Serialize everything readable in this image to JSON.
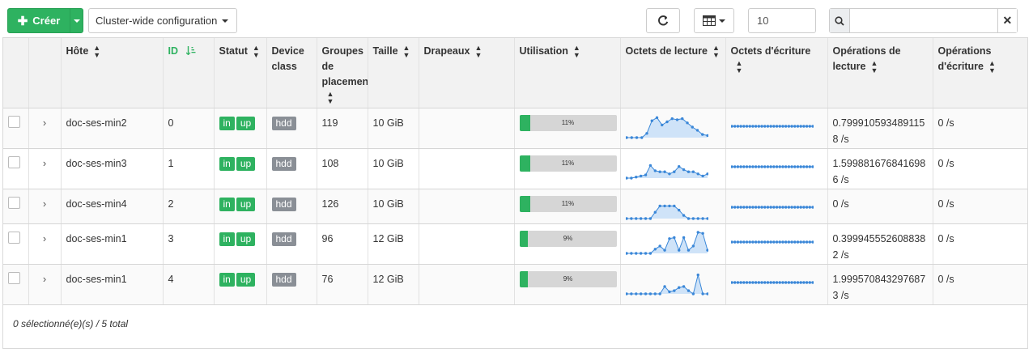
{
  "toolbar": {
    "create_label": "Créer",
    "cluster_label": "Cluster-wide configuration",
    "page_size": "10",
    "search_placeholder": "",
    "icons": {
      "create": "plus-icon",
      "refresh": "refresh-icon",
      "columns": "table-columns-icon",
      "search": "search-icon",
      "clear": "close-icon"
    }
  },
  "columns": {
    "host": "Hôte",
    "id": "ID",
    "status": "Statut",
    "device_class": "Device class",
    "pgs": "Groupes de placement",
    "size": "Taille",
    "flags": "Drapeaux",
    "usage": "Utilisation",
    "read_bytes": "Octets de lecture",
    "write_bytes": "Octets d'écriture",
    "read_ops": "Opérations de lecture",
    "write_ops": "Opérations d'écriture"
  },
  "rows": [
    {
      "host": "doc-ses-min2",
      "id": "0",
      "status": [
        "in",
        "up"
      ],
      "device_class": "hdd",
      "pgs": "119",
      "size": "10 GiB",
      "flags": "",
      "usage_pct": 11,
      "usage_label": "11%",
      "read_series": [
        0,
        0,
        0,
        0,
        0.2,
        0.8,
        0.95,
        0.6,
        0.75,
        0.9,
        0.85,
        0.9,
        0.7,
        0.5,
        0.35,
        0.15,
        0.1
      ],
      "write_series": [
        0,
        0,
        0,
        0,
        0,
        0,
        0,
        0,
        0,
        0,
        0,
        0,
        0,
        0,
        0,
        0,
        0,
        0,
        0,
        0,
        0,
        0,
        0,
        0,
        0,
        0,
        0,
        0
      ],
      "read_ops": "0.7999105934891158 /s",
      "write_ops": "0 /s"
    },
    {
      "host": "doc-ses-min3",
      "id": "1",
      "status": [
        "in",
        "up"
      ],
      "device_class": "hdd",
      "pgs": "108",
      "size": "10 GiB",
      "flags": "",
      "usage_pct": 11,
      "usage_label": "11%",
      "read_series": [
        0,
        0,
        0.05,
        0.1,
        0.15,
        0.6,
        0.35,
        0.3,
        0.3,
        0.2,
        0.3,
        0.55,
        0.4,
        0.3,
        0.3,
        0.2,
        0.1,
        0.2
      ],
      "write_series": [
        0,
        0,
        0,
        0,
        0,
        0,
        0,
        0,
        0,
        0,
        0,
        0,
        0,
        0,
        0,
        0,
        0,
        0,
        0,
        0,
        0,
        0,
        0,
        0,
        0,
        0,
        0,
        0
      ],
      "read_ops": "1.5998816768416986 /s",
      "write_ops": "0 /s"
    },
    {
      "host": "doc-ses-min4",
      "id": "2",
      "status": [
        "in",
        "up"
      ],
      "device_class": "hdd",
      "pgs": "126",
      "size": "10 GiB",
      "flags": "",
      "usage_pct": 11,
      "usage_label": "11%",
      "read_series": [
        0,
        0,
        0,
        0,
        0,
        0,
        0.3,
        0.6,
        0.6,
        0.6,
        0.6,
        0.4,
        0.15,
        0,
        0,
        0,
        0,
        0
      ],
      "write_series": [
        0,
        0,
        0,
        0,
        0,
        0,
        0,
        0,
        0,
        0,
        0,
        0,
        0,
        0,
        0,
        0,
        0,
        0,
        0,
        0,
        0,
        0,
        0,
        0,
        0,
        0,
        0,
        0
      ],
      "read_ops": "0 /s",
      "write_ops": "0 /s"
    },
    {
      "host": "doc-ses-min1",
      "id": "3",
      "status": [
        "in",
        "up"
      ],
      "device_class": "hdd",
      "pgs": "96",
      "size": "12 GiB",
      "flags": "",
      "usage_pct": 9,
      "usage_label": "9%",
      "read_series": [
        0,
        0,
        0,
        0,
        0,
        0,
        0.2,
        0.35,
        0.15,
        0.7,
        0.75,
        0.15,
        0.75,
        0.15,
        0.35,
        1,
        0.95,
        0.15
      ],
      "write_series": [
        0,
        0,
        0,
        0,
        0,
        0,
        0,
        0,
        0,
        0,
        0,
        0,
        0,
        0,
        0,
        0,
        0,
        0,
        0,
        0,
        0,
        0,
        0,
        0,
        0,
        0,
        0,
        0
      ],
      "read_ops": "0.3999455526088382 /s",
      "write_ops": "0 /s"
    },
    {
      "host": "doc-ses-min1",
      "id": "4",
      "status": [
        "in",
        "up"
      ],
      "device_class": "hdd",
      "pgs": "76",
      "size": "12 GiB",
      "flags": "",
      "usage_pct": 9,
      "usage_label": "9%",
      "read_series": [
        0,
        0,
        0,
        0,
        0,
        0,
        0,
        0,
        0.35,
        0.1,
        0.15,
        0.3,
        0.35,
        0.15,
        0,
        0.9,
        0,
        0
      ],
      "write_series": [
        0,
        0,
        0,
        0,
        0,
        0,
        0,
        0,
        0,
        0,
        0,
        0,
        0,
        0,
        0,
        0,
        0,
        0,
        0,
        0,
        0,
        0,
        0,
        0,
        0,
        0,
        0,
        0
      ],
      "read_ops": "1.9995708432976873 /s",
      "write_ops": "0 /s"
    }
  ],
  "footer": {
    "selection": "0 sélectionné(e)(s) / 5 total"
  },
  "colors": {
    "accent": "#2eb260",
    "spark_line": "#3a87d8",
    "spark_fill": "#cfe3f8",
    "badge_gray": "#8a8f96"
  }
}
